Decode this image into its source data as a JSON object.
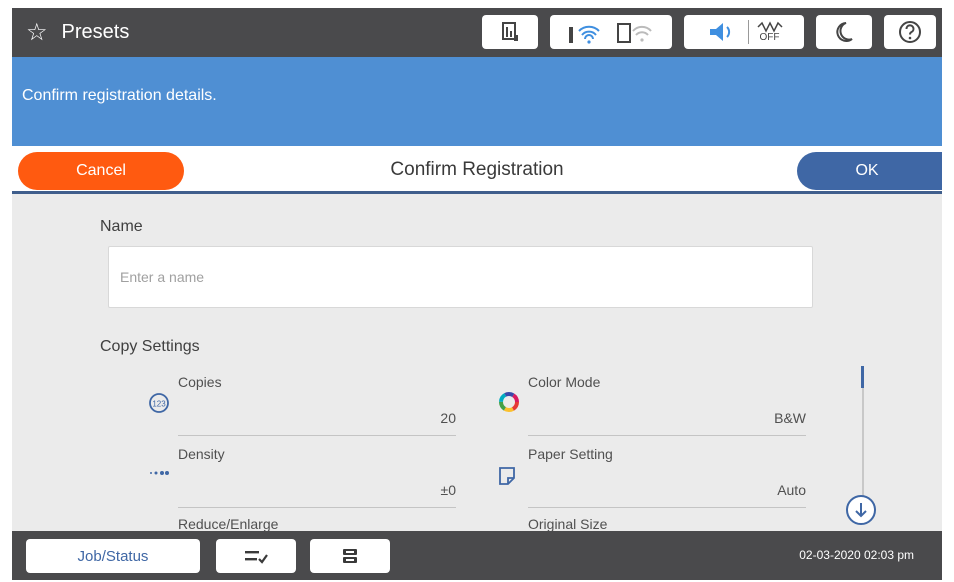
{
  "header": {
    "title": "Presets",
    "status_icons": [
      "ink-level-icon",
      "wifi-icon",
      "wifi-direct-icon",
      "sound-icon",
      "quiet-mode-off-icon",
      "sleep-mode-icon",
      "help-icon"
    ],
    "quiet_label": "OFF"
  },
  "banner": {
    "message": "Confirm registration details."
  },
  "actions": {
    "cancel_label": "Cancel",
    "title": "Confirm Registration",
    "ok_label": "OK"
  },
  "form": {
    "name_label": "Name",
    "name_placeholder": "Enter a name",
    "name_value": ""
  },
  "copy_settings": {
    "heading": "Copy Settings",
    "items": [
      {
        "label": "Copies",
        "value": "20",
        "icon": "copies-icon"
      },
      {
        "label": "Color Mode",
        "value": "B&W",
        "icon": "color-mode-icon"
      },
      {
        "label": "Density",
        "value": "±0",
        "icon": "density-icon"
      },
      {
        "label": "Paper Setting",
        "value": "Auto",
        "icon": "paper-setting-icon"
      },
      {
        "label": "Reduce/Enlarge",
        "value": "",
        "icon": ""
      },
      {
        "label": "Original Size",
        "value": "",
        "icon": ""
      }
    ]
  },
  "footer": {
    "job_status_label": "Job/Status",
    "datetime": "02-03-2020 02:03 pm"
  },
  "colors": {
    "accent_blue": "#3f67a5",
    "banner_blue": "#4f8fd3",
    "cancel_orange": "#ff5a10",
    "bar_gray": "#4a4a4c"
  }
}
